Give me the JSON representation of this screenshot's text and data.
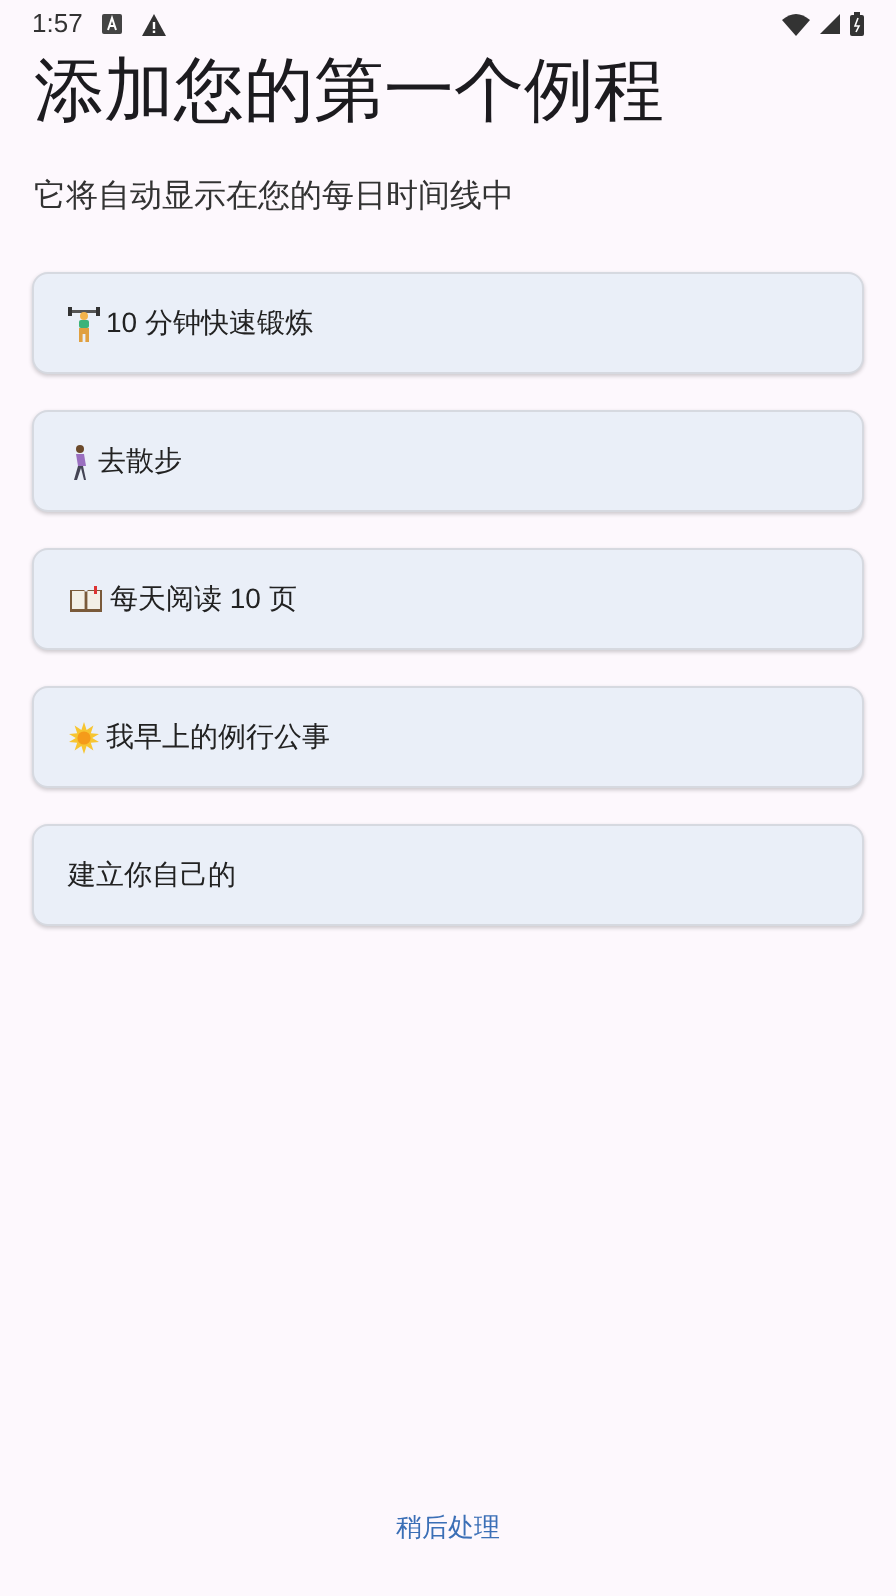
{
  "status_bar": {
    "time": "1:57"
  },
  "title": "添加您的第一个例程",
  "subtitle": "它将自动显示在您的每日时间线中",
  "routines": [
    {
      "kind": "weightlifter",
      "label": "10 分钟快速锻炼"
    },
    {
      "kind": "walker",
      "label": "去散步"
    },
    {
      "kind": "book",
      "label": "每天阅读 10 页"
    },
    {
      "kind": "sun",
      "label": "我早上的例行公事"
    },
    {
      "kind": "none",
      "label": "建立你自己的"
    }
  ],
  "skip_button": "稍后处理"
}
